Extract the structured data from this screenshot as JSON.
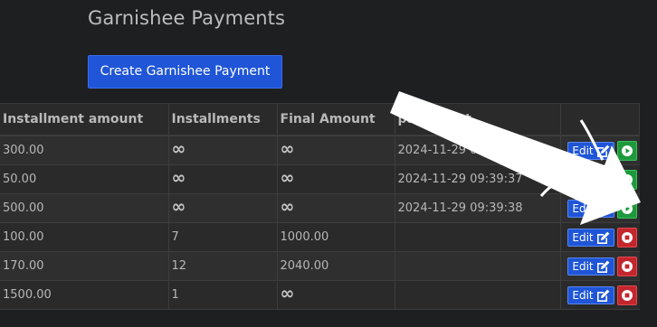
{
  "page": {
    "title": "Garnishee Payments",
    "create_button_label": "Create Garnishee Payment"
  },
  "table": {
    "headers": {
      "installment_amount": "Installment amount",
      "installments": "Installments",
      "final_amount": "Final Amount",
      "paid_off_at": "paid off at"
    },
    "edit_label": "Edit",
    "rows": [
      {
        "amount": "300.00",
        "installments": "∞",
        "final_amount": "∞",
        "paid_off_at": "2024-11-29 09:39:38",
        "status": "paid"
      },
      {
        "amount": "50.00",
        "installments": "∞",
        "final_amount": "∞",
        "paid_off_at": "2024-11-29 09:39:37",
        "status": "paid"
      },
      {
        "amount": "500.00",
        "installments": "∞",
        "final_amount": "∞",
        "paid_off_at": "2024-11-29 09:39:38",
        "status": "paid"
      },
      {
        "amount": "100.00",
        "installments": "7",
        "final_amount": "1000.00",
        "paid_off_at": "",
        "status": "active"
      },
      {
        "amount": "170.00",
        "installments": "12",
        "final_amount": "2040.00",
        "paid_off_at": "",
        "status": "active"
      },
      {
        "amount": "1500.00",
        "installments": "1",
        "final_amount": "∞",
        "paid_off_at": "",
        "status": "active"
      }
    ]
  },
  "colors": {
    "background": "#1e1f20",
    "primary_button": "#1f55d6",
    "play_button": "#1e9a3c",
    "stop_button": "#c3262c",
    "annotation_arrow": "#ffffff"
  },
  "icons": {
    "edit": "edit-icon",
    "play": "play-circle-icon",
    "stop": "stop-circle-icon",
    "annotation": "annotation-arrow-icon"
  }
}
